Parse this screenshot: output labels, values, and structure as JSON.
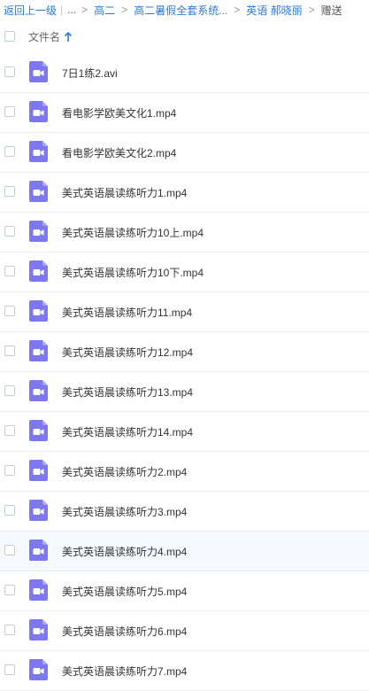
{
  "breadcrumb": {
    "back": "返回上一级",
    "ellipsis": "...",
    "items": [
      "高二",
      "高二暑假全套系统...",
      "英语 郝晓丽"
    ],
    "current": "赠送"
  },
  "table": {
    "name_header": "文件名",
    "sort_direction": "ascending"
  },
  "files": [
    {
      "name": "7日1练2.avi"
    },
    {
      "name": "看电影学欧美文化1.mp4"
    },
    {
      "name": "看电影学欧美文化2.mp4"
    },
    {
      "name": "美式英语晨读练听力1.mp4"
    },
    {
      "name": "美式英语晨读练听力10上.mp4"
    },
    {
      "name": "美式英语晨读练听力10下.mp4"
    },
    {
      "name": "美式英语晨读练听力11.mp4"
    },
    {
      "name": "美式英语晨读练听力12.mp4"
    },
    {
      "name": "美式英语晨读练听力13.mp4"
    },
    {
      "name": "美式英语晨读练听力14.mp4"
    },
    {
      "name": "美式英语晨读练听力2.mp4"
    },
    {
      "name": "美式英语晨读练听力3.mp4"
    },
    {
      "name": "美式英语晨读练听力4.mp4"
    },
    {
      "name": "美式英语晨读练听力5.mp4"
    },
    {
      "name": "美式英语晨读练听力6.mp4"
    },
    {
      "name": "美式英语晨读练听力7.mp4"
    }
  ],
  "hovered_row": 12,
  "colors": {
    "link": "#2b7bd6",
    "video_icon": "#7c78f0",
    "hover_row": "#f5f8fd"
  },
  "icons": {
    "file_type": "video-file-icon",
    "sort": "arrow-up-icon"
  }
}
